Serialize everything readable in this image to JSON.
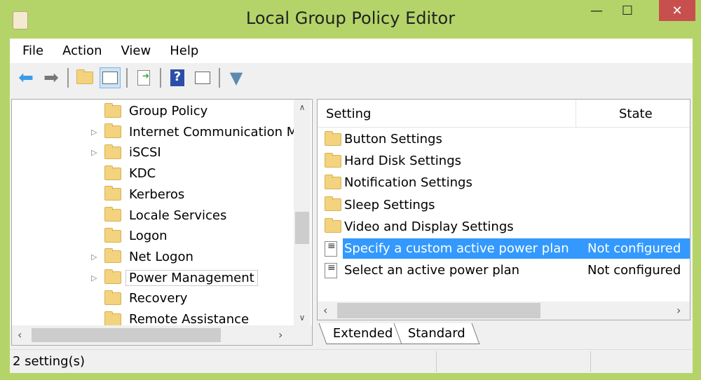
{
  "window": {
    "title": "Local Group Policy Editor",
    "minimize": "—",
    "maximize": "☐",
    "close": "✕"
  },
  "menu": [
    "File",
    "Action",
    "View",
    "Help"
  ],
  "toolbar": [
    "back-icon",
    "forward-icon",
    "up-folder-icon",
    "show-hide-tree-icon",
    "export-list-icon",
    "help-icon",
    "show-action-pane-icon",
    "filter-icon"
  ],
  "tree": [
    {
      "label": "Group Policy",
      "expandable": false
    },
    {
      "label": "Internet Communication M",
      "expandable": true
    },
    {
      "label": "iSCSI",
      "expandable": true
    },
    {
      "label": "KDC",
      "expandable": false
    },
    {
      "label": "Kerberos",
      "expandable": false
    },
    {
      "label": "Locale Services",
      "expandable": false
    },
    {
      "label": "Logon",
      "expandable": false
    },
    {
      "label": "Net Logon",
      "expandable": true
    },
    {
      "label": "Power Management",
      "expandable": true,
      "selected": true
    },
    {
      "label": "Recovery",
      "expandable": false
    },
    {
      "label": "Remote Assistance",
      "expandable": false
    }
  ],
  "list": {
    "columns": [
      "Setting",
      "State"
    ],
    "rows": [
      {
        "type": "folder",
        "setting": "Button Settings",
        "state": ""
      },
      {
        "type": "folder",
        "setting": "Hard Disk Settings",
        "state": ""
      },
      {
        "type": "folder",
        "setting": "Notification Settings",
        "state": ""
      },
      {
        "type": "folder",
        "setting": "Sleep Settings",
        "state": ""
      },
      {
        "type": "folder",
        "setting": "Video and Display Settings",
        "state": ""
      },
      {
        "type": "policy",
        "setting": "Specify a custom active power plan",
        "state": "Not configured",
        "selected": true
      },
      {
        "type": "policy",
        "setting": "Select an active power plan",
        "state": "Not configured"
      }
    ]
  },
  "tabs": [
    "Extended",
    "Standard"
  ],
  "status": "2 setting(s)",
  "colors": {
    "frame": "#b4d469",
    "selection": "#3399ff",
    "close": "#c7504f"
  }
}
